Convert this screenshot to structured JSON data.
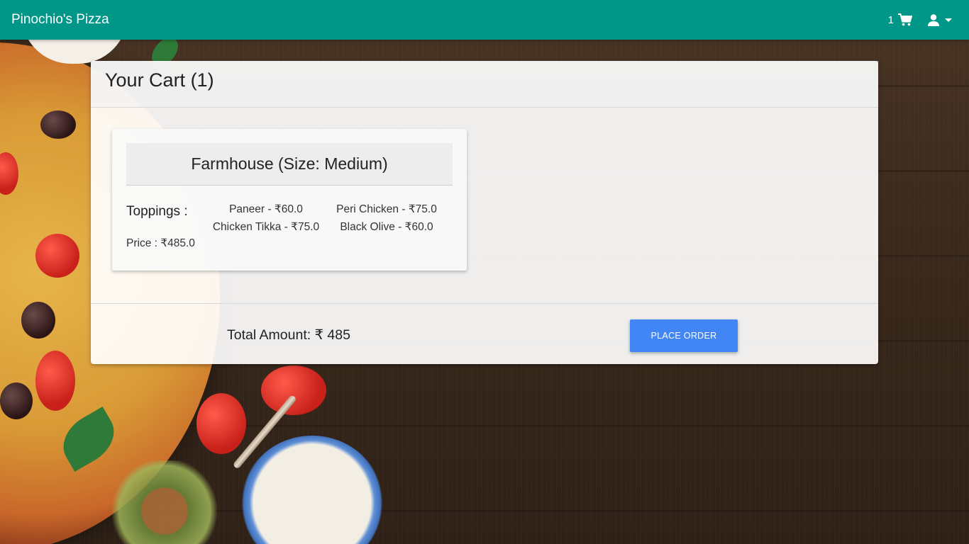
{
  "navbar": {
    "brand": "Pinochio's Pizza",
    "cart_count": "1",
    "cart_icon": "shopping-cart-icon",
    "user_icon": "user-icon",
    "nav_color": "#009688"
  },
  "cart": {
    "title": "Your Cart (1)",
    "items": [
      {
        "title": "Farmhouse (Size: Medium)",
        "toppings_label": "Toppings :",
        "toppings": [
          "Paneer - ₹60.0",
          "Peri Chicken - ₹75.0",
          "Chicken Tikka - ₹75.0",
          "Black Olive - ₹60.0"
        ],
        "price": "Price : ₹485.0"
      }
    ],
    "total": "Total Amount: ₹ 485",
    "place_order_label": "PLACE ORDER",
    "button_color": "#4285f4"
  }
}
